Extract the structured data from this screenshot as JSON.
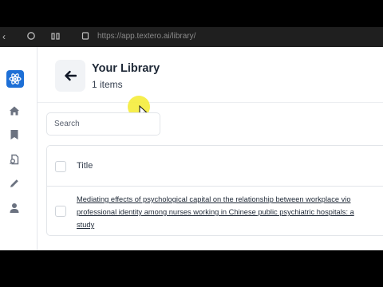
{
  "browser": {
    "url": "https://app.textero.ai/library/"
  },
  "sidebar": {
    "items": [
      {
        "icon": "home-icon"
      },
      {
        "icon": "bookmark-icon"
      },
      {
        "icon": "document-search-icon"
      },
      {
        "icon": "pencil-icon"
      },
      {
        "icon": "user-icon"
      }
    ]
  },
  "header": {
    "title": "Your Library",
    "count": "1 items"
  },
  "search": {
    "placeholder": "Search"
  },
  "table": {
    "columns": [
      "Title"
    ],
    "rows": [
      {
        "title_lines": [
          "Mediating effects of psychological capital on the relationship between workplace vio",
          "professional identity among nurses working in Chinese public psychiatric hospitals: a",
          "study"
        ]
      }
    ]
  },
  "colors": {
    "accent": "#1d6fd6",
    "cursor_highlight": "#f5ec3b"
  }
}
